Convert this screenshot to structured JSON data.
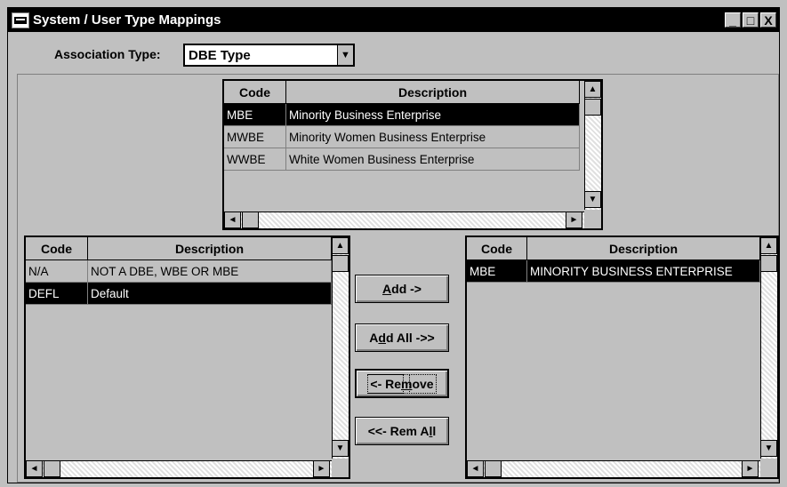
{
  "window": {
    "title": "System / User Type Mappings",
    "buttons": [
      "_",
      "□",
      "X"
    ]
  },
  "association": {
    "label": "Association Type:",
    "value": "DBE Type"
  },
  "top_grid": {
    "headers": [
      "Code",
      "Description"
    ],
    "rows": [
      {
        "code": "MBE",
        "desc": "Minority Business Enterprise",
        "selected": true
      },
      {
        "code": "MWBE",
        "desc": "Minority Women Business Enterprise",
        "selected": false
      },
      {
        "code": "WWBE",
        "desc": "White Women Business Enterprise",
        "selected": false
      }
    ]
  },
  "left_grid": {
    "headers": [
      "Code",
      "Description"
    ],
    "rows": [
      {
        "code": "N/A",
        "desc": "NOT A DBE, WBE OR MBE",
        "selected": false
      },
      {
        "code": "DEFL",
        "desc": "Default",
        "selected": true
      }
    ]
  },
  "right_grid": {
    "headers": [
      "Code",
      "Description"
    ],
    "rows": [
      {
        "code": "MBE",
        "desc": "MINORITY BUSINESS ENTERPRISE",
        "selected": true
      }
    ]
  },
  "buttons": {
    "add": {
      "pre": "",
      "u": "A",
      "post": "dd ->"
    },
    "add_all": {
      "pre": "A",
      "u": "d",
      "post": "d All ->>"
    },
    "remove": {
      "pre": "<- Re",
      "u": "m",
      "post": "ove"
    },
    "rem_all": {
      "pre": "<<- Rem A",
      "u": "l",
      "post": "l"
    }
  },
  "scroll_glyphs": {
    "up": "▲",
    "down": "▼",
    "left": "◄",
    "right": "►"
  }
}
